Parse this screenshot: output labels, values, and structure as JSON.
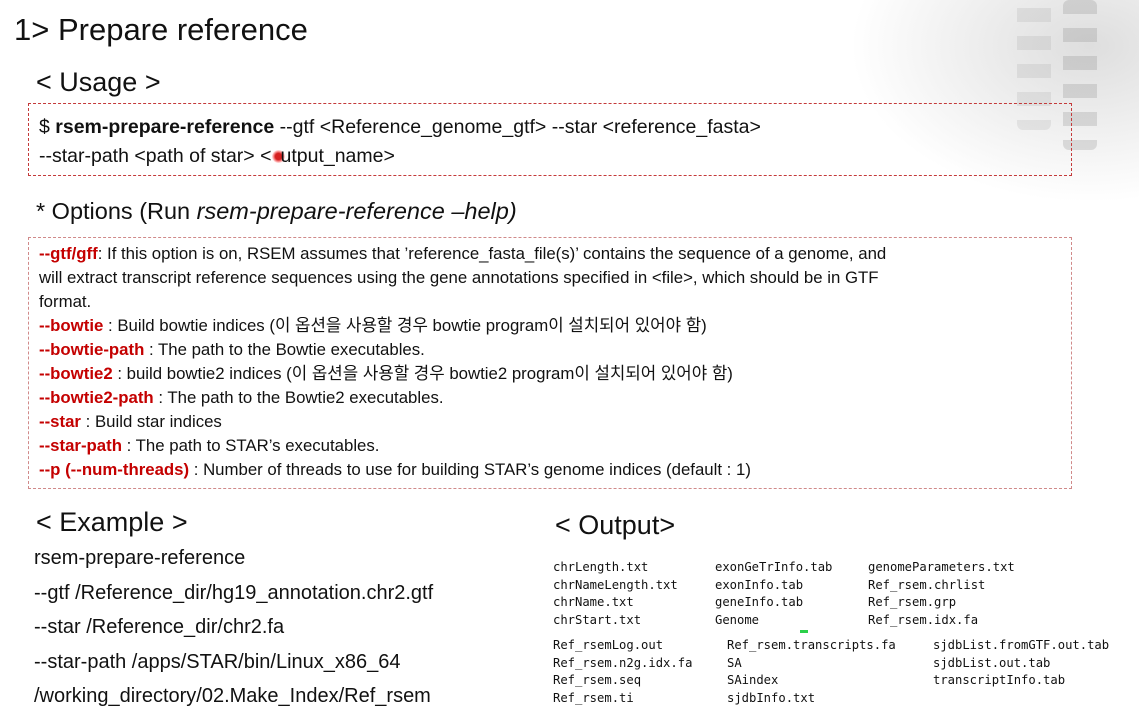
{
  "title": "1> Prepare reference",
  "usage": {
    "heading": "< Usage >",
    "cmd_prefix": "$ ",
    "cmd_bold": "rsem-prepare-reference",
    "cmd_rest": " --gtf <Reference_genome_gtf> --star <reference_fasta>",
    "line2_a": "--star-path <path of star> <",
    "line2_b": "utput_name>"
  },
  "options": {
    "heading_prefix": "* Options (Run ",
    "heading_italic": "rsem-prepare-reference –help)",
    "items": [
      {
        "key": "--gtf/gff",
        "text": ": If this option is on, RSEM assumes that ’reference_fasta_file(s)’ contains the sequence of a genome, and"
      },
      {
        "key": "",
        "text": "will extract transcript reference sequences using the gene annotations specified in <file>, which should be in GTF"
      },
      {
        "key": "",
        "text": "format."
      },
      {
        "key": "--bowtie",
        "text": " : Build bowtie indices (이 옵션을 사용할 경우 bowtie program이 설치되어 있어야 함)"
      },
      {
        "key": "--bowtie-path",
        "text": " : The path to the Bowtie executables."
      },
      {
        "key": "--bowtie2",
        "text": " : build bowtie2 indices (이 옵션을 사용할 경우 bowtie2 program이 설치되어 있어야 함)"
      },
      {
        "key": "--bowtie2-path",
        "text": " : The path to the Bowtie2 executables."
      },
      {
        "key": "--star",
        "text": " : Build star indices"
      },
      {
        "key": "--star-path",
        "text": " : The path to STAR’s executables."
      },
      {
        "key": "--p (--num-threads)",
        "text": " : Number of threads to use for building STAR’s genome indices (default : 1)"
      }
    ]
  },
  "example": {
    "heading": "< Example >",
    "lines": [
      "rsem-prepare-reference",
      "--gtf /Reference_dir/hg19_annotation.chr2.gtf",
      "--star /Reference_dir/chr2.fa",
      "--star-path /apps/STAR/bin/Linux_x86_64",
      "/working_directory/02.Make_Index/Ref_rsem"
    ]
  },
  "output": {
    "heading": "< Output>",
    "group1": [
      [
        "chrLength.txt",
        "chrNameLength.txt",
        "chrName.txt",
        "chrStart.txt"
      ],
      [
        "exonGeTrInfo.tab",
        "exonInfo.tab",
        "geneInfo.tab",
        "Genome"
      ],
      [
        "genomeParameters.txt",
        "Ref_rsem.chrlist",
        "Ref_rsem.grp",
        "Ref_rsem.idx.fa"
      ]
    ],
    "group2": [
      [
        "Ref_rsemLog.out",
        "Ref_rsem.n2g.idx.fa",
        "Ref_rsem.seq",
        "Ref_rsem.ti"
      ],
      [
        "Ref_rsem.transcripts.fa",
        "SA",
        "SAindex",
        "sjdbInfo.txt"
      ],
      [
        "sjdbList.fromGTF.out.tab",
        "sjdbList.out.tab",
        "transcriptInfo.tab"
      ]
    ]
  }
}
